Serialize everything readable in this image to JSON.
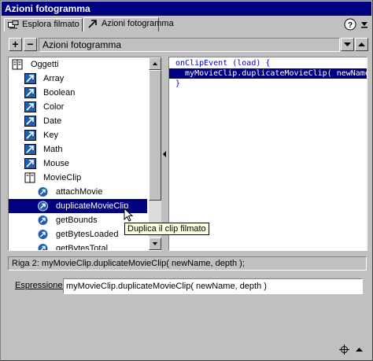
{
  "window": {
    "title": "Azioni fotogramma"
  },
  "tabs": [
    {
      "label": "Esplora filmato",
      "icon": "movie-explorer-icon"
    },
    {
      "label": "Azioni fotogramma",
      "icon": "actions-arrow-icon"
    }
  ],
  "toolbar": {
    "add_label": "+",
    "remove_label": "−",
    "panel_title": "Azioni fotogramma",
    "help_icon": "help-icon",
    "menu_icon": "menu-arrow-icon"
  },
  "tree": {
    "items": [
      {
        "label": "Oggetti",
        "icon": "book-icon",
        "level": 0
      },
      {
        "label": "Array",
        "icon": "action-book-icon",
        "level": 1
      },
      {
        "label": "Boolean",
        "icon": "action-book-icon",
        "level": 1
      },
      {
        "label": "Color",
        "icon": "action-book-icon",
        "level": 1
      },
      {
        "label": "Date",
        "icon": "action-book-icon",
        "level": 1
      },
      {
        "label": "Key",
        "icon": "action-book-icon",
        "level": 1
      },
      {
        "label": "Math",
        "icon": "action-book-icon",
        "level": 1
      },
      {
        "label": "Mouse",
        "icon": "action-book-icon",
        "level": 1
      },
      {
        "label": "MovieClip",
        "icon": "open-book-icon",
        "level": 1
      },
      {
        "label": "attachMovie",
        "icon": "action-icon",
        "level": 2
      },
      {
        "label": "duplicateMovieClip",
        "icon": "action-icon",
        "level": 2,
        "selected": true
      },
      {
        "label": "getBounds",
        "icon": "action-icon",
        "level": 2
      },
      {
        "label": "getBytesLoaded",
        "icon": "action-icon",
        "level": 2
      },
      {
        "label": "getBytesTotal",
        "icon": "action-icon",
        "level": 2
      }
    ]
  },
  "code": {
    "lines": [
      {
        "text": "onClipEvent (load) {",
        "selected": false
      },
      {
        "text": "  myMovieClip.duplicateMovieClip( newName, depth );",
        "selected": true
      },
      {
        "text": "}",
        "selected": false
      }
    ]
  },
  "tooltip": {
    "text": "Duplica il clip filmato"
  },
  "status": {
    "text": "Riga 2: myMovieClip.duplicateMovieClip( newName, depth );"
  },
  "expression": {
    "label": "Espressione:",
    "value": "myMovieClip.duplicateMovieClip( newName, depth )"
  },
  "colors": {
    "title_bg": "#000080",
    "selection_bg": "#000080",
    "tooltip_bg": "#ffffe1",
    "panel_bg": "#c0c0c0"
  }
}
